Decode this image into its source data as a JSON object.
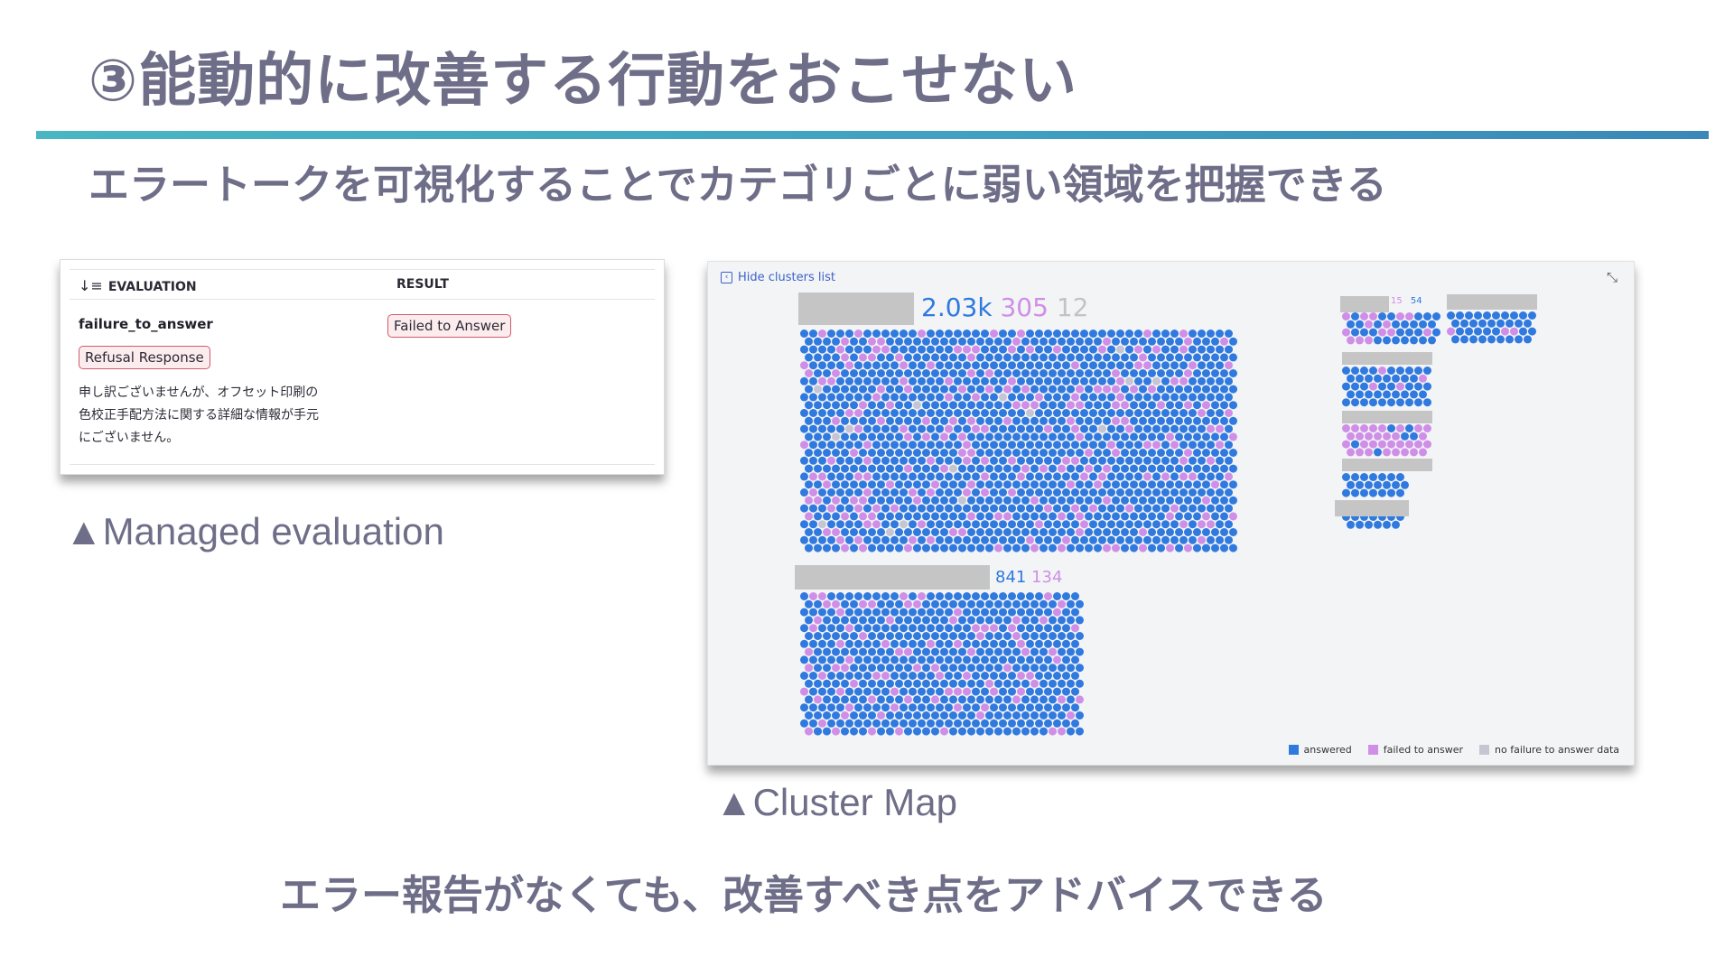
{
  "slide": {
    "title": "③能動的に改善する行動をおこせない",
    "subtitle": "エラートークを可視化することでカテゴリごとに弱い領域を把握できる",
    "footer": "エラー報告がなくても、改善すべき点をアドバイスできる",
    "caption_left": "▲Managed evaluation",
    "caption_right": "▲Cluster Map"
  },
  "evaluation": {
    "col_evaluation": "EVALUATION",
    "col_result": "RESULT",
    "metric_name": "failure_to_answer",
    "tag": "Refusal Response",
    "result_badge": "Failed to Answer",
    "body_lines": [
      "申し訳ございませんが、オフセット印刷の",
      "色校正手配方法に関する詳細な情報が手元",
      "にございません。"
    ]
  },
  "cluster_map": {
    "hide_link": "Hide clusters list",
    "clusters": [
      {
        "counts": [
          "2.03k",
          "305",
          "12"
        ],
        "failed_ratio": 0.15,
        "none_ratio": 0.006
      },
      {
        "counts": [
          "841",
          "134"
        ],
        "failed_ratio": 0.14,
        "none_ratio": 0
      },
      {
        "counts": [
          "15",
          "54"
        ],
        "failed_ratio": 0.22,
        "none_ratio": 0
      }
    ],
    "legend": [
      {
        "label": "answered",
        "color": "#2f79df"
      },
      {
        "label": "failed to answer",
        "color": "#cf8fe7"
      },
      {
        "label": "no failure to answer data",
        "color": "#c6c6d2"
      }
    ]
  }
}
